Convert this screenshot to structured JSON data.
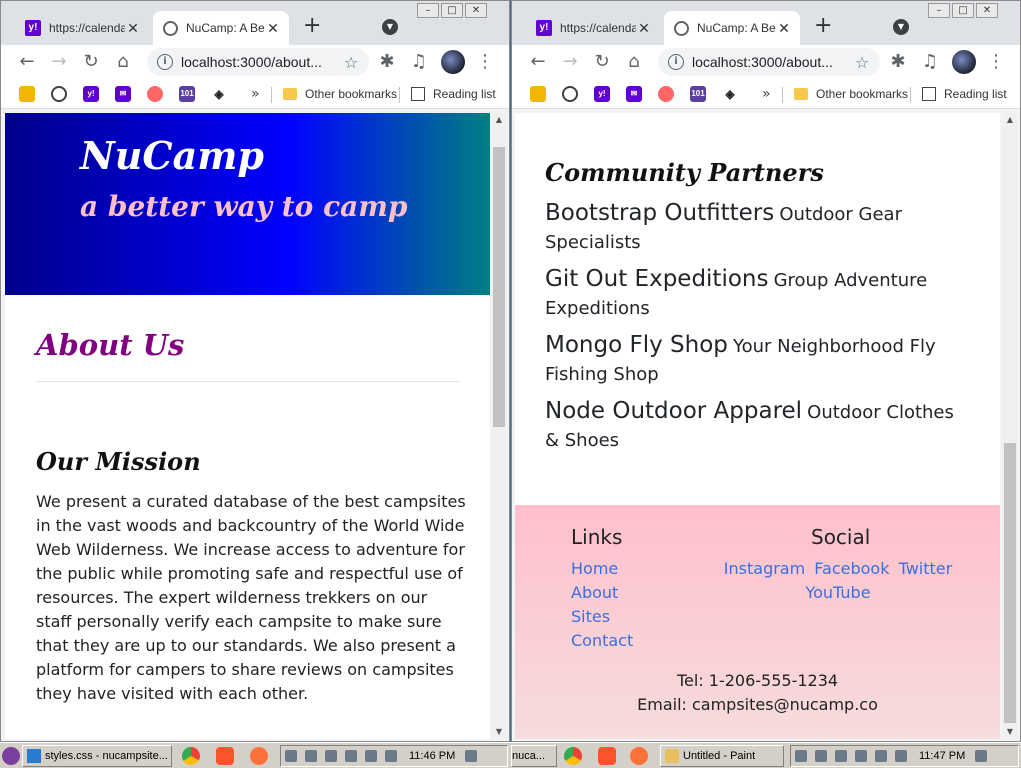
{
  "left_window": {
    "tabs": [
      {
        "title": "https://calenda"
      },
      {
        "title": "NuCamp: A Be"
      }
    ],
    "url": "localhost:3000/about...",
    "bookmarks": {
      "more": "»",
      "other": "Other bookmarks",
      "reading": "Reading list"
    },
    "page": {
      "brand": "NuCamp",
      "tagline": "a better way to camp",
      "about_heading": "About Us",
      "mission_heading": "Our Mission",
      "mission_text": "We present a curated database of the best campsites in the vast woods and backcountry of the World Wide Web Wilderness. We increase access to adventure for the public while promoting safe and respectful use of resources. The expert wilderness trekkers on our staff personally verify each campsite to make sure that they are up to our standards. We also present a platform for campers to share reviews on campsites they have visited with each other."
    },
    "scroll_fraction": 0.12
  },
  "right_window": {
    "tabs": [
      {
        "title": "https://calenda"
      },
      {
        "title": "NuCamp: A Be"
      }
    ],
    "url": "localhost:3000/about...",
    "bookmarks": {
      "more": "»",
      "other": "Other bookmarks",
      "reading": "Reading list"
    },
    "page": {
      "partners_heading": "Community Partners",
      "partners": [
        {
          "name": "Bootstrap Outfitters",
          "desc": "Outdoor Gear Specialists"
        },
        {
          "name": "Git Out Expeditions",
          "desc": "Group Adventure Expeditions"
        },
        {
          "name": "Mongo Fly Shop",
          "desc": "Your Neighborhood Fly Fishing Shop"
        },
        {
          "name": "Node Outdoor Apparel",
          "desc": "Outdoor Clothes & Shoes"
        }
      ],
      "footer": {
        "links_heading": "Links",
        "links": [
          "Home",
          "About",
          "Sites",
          "Contact"
        ],
        "social_heading": "Social",
        "social": [
          "Instagram",
          "Facebook",
          "Twitter",
          "YouTube"
        ],
        "tel": "Tel: 1-206-555-1234",
        "email": "Email: campsites@nucamp.co"
      }
    },
    "scroll_fraction": 1.0
  },
  "taskbar": {
    "left_items": [
      "styles.css - nucampsite..."
    ],
    "left_clock": "11:46 PM",
    "right_items": [
      "nuca...",
      "Untitled - Paint"
    ],
    "right_clock": "11:47 PM"
  },
  "colors": {
    "jumbotron_start": "#00008b",
    "jumbotron_mid": "#0000ff",
    "jumbotron_end": "#008080",
    "tagline": "#ffc0cb",
    "about_heading": "#800080",
    "footer_bg": "#ffc0cb",
    "link": "#3c6ee0"
  }
}
